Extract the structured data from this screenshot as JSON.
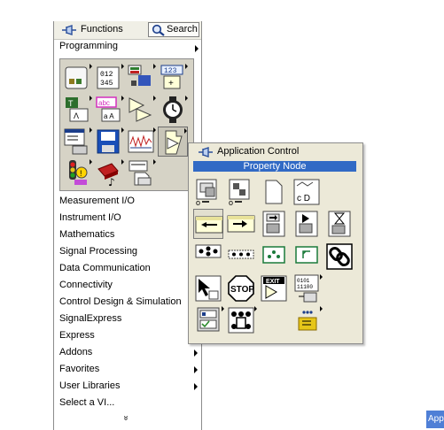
{
  "functions_palette": {
    "title": "Functions",
    "search_label": "Search",
    "current_category": "Programming",
    "icon_names": [
      "cluster-class-variant-icon",
      "numeric-array-icon",
      "boolean-icon",
      "numeric-icon",
      "comparison-icon",
      "string-icon",
      "compare-icon",
      "timing-icon",
      "dialog-ui-icon",
      "file-io-icon",
      "waveform-icon",
      "application-control-icon",
      "synchronization-icon",
      "graphics-sound-icon",
      "report-generation-icon"
    ],
    "menu_items": [
      {
        "label": "Measurement I/O",
        "has_submenu": true
      },
      {
        "label": "Instrument I/O",
        "has_submenu": true
      },
      {
        "label": "Mathematics",
        "has_submenu": true
      },
      {
        "label": "Signal Processing",
        "has_submenu": true
      },
      {
        "label": "Data Communication",
        "has_submenu": true
      },
      {
        "label": "Connectivity",
        "has_submenu": true
      },
      {
        "label": "Control Design & Simulation",
        "has_submenu": true
      },
      {
        "label": "SignalExpress",
        "has_submenu": true
      },
      {
        "label": "Express",
        "has_submenu": true
      },
      {
        "label": "Addons",
        "has_submenu": true
      },
      {
        "label": "Favorites",
        "has_submenu": true
      },
      {
        "label": "User Libraries",
        "has_submenu": true
      },
      {
        "label": "Select a VI...",
        "has_submenu": false
      }
    ],
    "more_indicator": "»"
  },
  "application_control": {
    "title": "Application Control",
    "highlighted_item": "Property Node",
    "icon_names": [
      "open-vi-reference-icon",
      "open-app-reference-icon",
      "static-vi-reference-icon",
      "close-reference-icon",
      "property-node-icon",
      "invoke-node-icon",
      "call-by-reference-icon",
      "start-asynchronous-call-icon",
      "wait-on-asynchronous-call-icon",
      "menu-functions-icon",
      "to-more-generic-class-icon",
      "to-more-specific-class-icon",
      "link-icon",
      "cursor-vis-icon",
      "stop-icon",
      "quit-labview-icon",
      "flatten-unflatten-icon",
      "vi-server-icon",
      "events-icon",
      "call-chain-icon"
    ],
    "stop_text": "STOP",
    "exit_text": "EXIT",
    "ref_text": "c D",
    "binary_text": "0101 11100 0110"
  },
  "corner_tab": {
    "label": "App"
  },
  "colors": {
    "highlight": "#316ac5",
    "palette_bg": "#ece9d8",
    "grid_bg": "#d6d3c6"
  }
}
